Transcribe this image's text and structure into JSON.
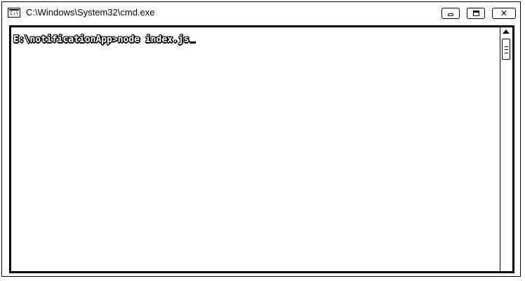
{
  "window": {
    "title": "C:\\Windows\\System32\\cmd.exe",
    "icon": "console-app-icon",
    "controls": {
      "minimize_icon": "minimize-icon",
      "maximize_icon": "maximize-icon",
      "close_label": "✕"
    }
  },
  "console": {
    "prompt": "E:\\notificationApp>node index.js",
    "text_color": "#ffffff",
    "background": "#ffffff"
  }
}
